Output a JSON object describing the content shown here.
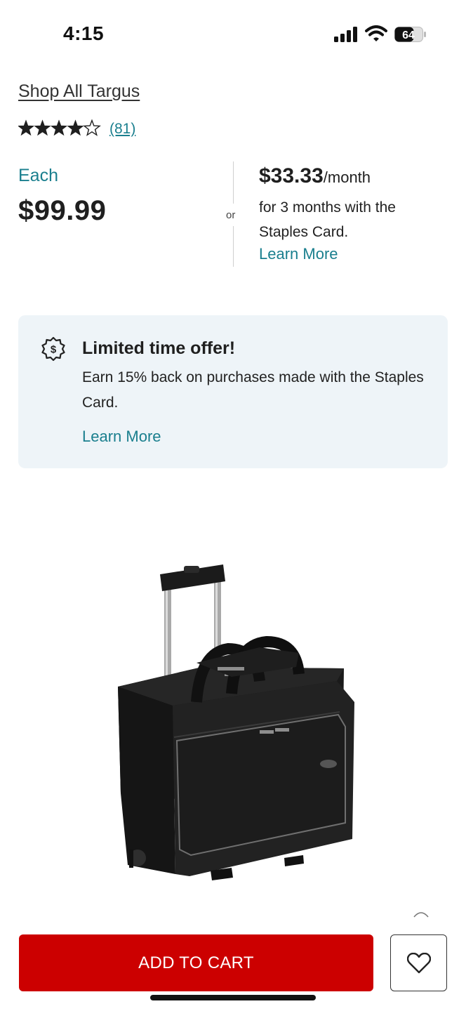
{
  "status_bar": {
    "time": "4:15",
    "battery": "64"
  },
  "brand_link": "Shop All Targus",
  "rating": {
    "stars": 4,
    "max": 5,
    "count_label": "(81)"
  },
  "pricing": {
    "each_label": "Each",
    "price": "$99.99",
    "or_label": "or",
    "monthly_amount": "$33.33",
    "monthly_unit": "/month",
    "monthly_terms": "for 3 months with the Staples Card.",
    "learn_more": "Learn More"
  },
  "promo": {
    "title": "Limited time offer!",
    "body": "Earn 15% back on purchases made with the Staples Card.",
    "learn_more": "Learn More"
  },
  "product_image": {
    "icon": "rolling-laptop-case-image"
  },
  "actions": {
    "add_to_cart": "ADD TO CART",
    "favorite_icon": "heart-icon"
  },
  "colors": {
    "accent": "#1a7f8e",
    "cart_red": "#cc0000",
    "promo_bg": "#eef4f8"
  }
}
